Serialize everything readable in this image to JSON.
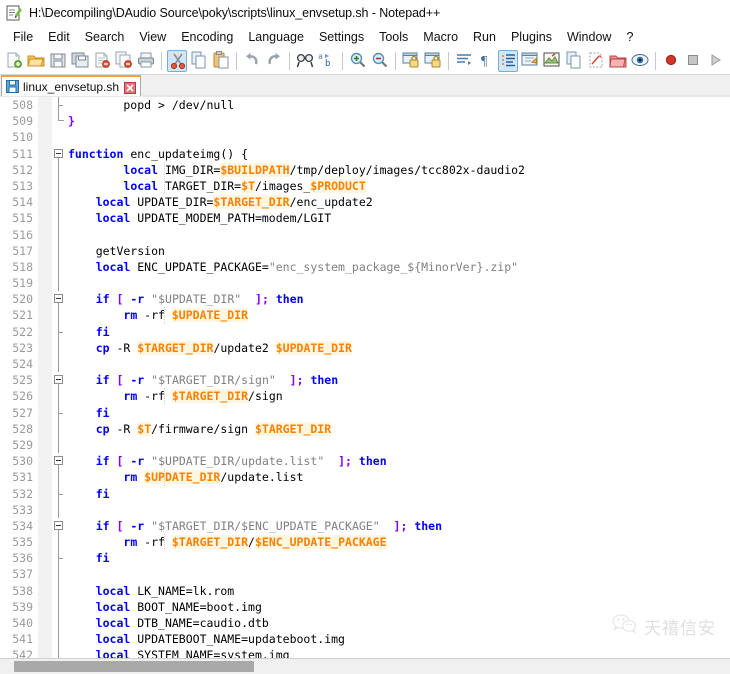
{
  "window": {
    "title": "H:\\Decompiling\\DAudio Source\\poky\\scripts\\linux_envsetup.sh - Notepad++",
    "app_icon": "notepad-plus-plus-icon"
  },
  "menubar": {
    "items": [
      {
        "label": "File"
      },
      {
        "label": "Edit"
      },
      {
        "label": "Search"
      },
      {
        "label": "View"
      },
      {
        "label": "Encoding"
      },
      {
        "label": "Language"
      },
      {
        "label": "Settings"
      },
      {
        "label": "Tools"
      },
      {
        "label": "Macro"
      },
      {
        "label": "Run"
      },
      {
        "label": "Plugins"
      },
      {
        "label": "Window"
      },
      {
        "label": "?"
      }
    ]
  },
  "toolbar": {
    "buttons": [
      {
        "name": "new-file-icon"
      },
      {
        "name": "open-file-icon"
      },
      {
        "name": "save-icon"
      },
      {
        "name": "save-all-icon"
      },
      {
        "name": "close-file-icon"
      },
      {
        "name": "close-all-icon"
      },
      {
        "name": "print-icon"
      },
      {
        "name": "cut-icon"
      },
      {
        "name": "copy-icon"
      },
      {
        "name": "paste-icon"
      },
      {
        "name": "undo-icon"
      },
      {
        "name": "redo-icon"
      },
      {
        "name": "find-icon"
      },
      {
        "name": "replace-icon"
      },
      {
        "name": "zoom-in-icon"
      },
      {
        "name": "zoom-out-icon"
      },
      {
        "name": "sync-vertical-scroll-icon"
      },
      {
        "name": "sync-horizontal-scroll-icon"
      },
      {
        "name": "word-wrap-icon"
      },
      {
        "name": "show-all-characters-icon"
      },
      {
        "name": "show-indent-guide-icon"
      },
      {
        "name": "user-defined-dialog-icon"
      },
      {
        "name": "document-map-icon"
      },
      {
        "name": "function-list-icon"
      },
      {
        "name": "folder-as-workspace-icon"
      },
      {
        "name": "monitoring-icon"
      },
      {
        "name": "record-macro-icon"
      },
      {
        "name": "stop-macro-icon"
      },
      {
        "name": "playback-macro-icon"
      }
    ]
  },
  "tabs": [
    {
      "label": "linux_envsetup.sh",
      "save_icon": "save-blue-icon",
      "close_icon": "close-red-icon",
      "active": true
    }
  ],
  "editor": {
    "first_line": 508,
    "lines": [
      {
        "n": 508,
        "fold": "line-end-tick",
        "indent_guides": [],
        "tokens": [
          {
            "t": "        popd > /dev/null",
            "c": "plain"
          }
        ]
      },
      {
        "n": 509,
        "fold": "end",
        "indent_guides": [],
        "tokens": [
          {
            "t": "}",
            "c": "op"
          }
        ]
      },
      {
        "n": 510,
        "fold": "none",
        "indent_guides": [],
        "tokens": []
      },
      {
        "n": 511,
        "fold": "box-open",
        "indent_guides": [],
        "tokens": [
          {
            "t": "function",
            "c": "kw"
          },
          {
            "t": " enc_updateimg() {",
            "c": "plain"
          }
        ]
      },
      {
        "n": 512,
        "fold": "line",
        "indent_guides": [
          98
        ],
        "tokens": [
          {
            "t": "        ",
            "c": "plain"
          },
          {
            "t": "local",
            "c": "kw"
          },
          {
            "t": " IMG_DIR=",
            "c": "plain"
          },
          {
            "t": "$BUILDPATH",
            "c": "var"
          },
          {
            "t": "/tmp/deploy/images/tcc802x-daudio2",
            "c": "plain"
          }
        ]
      },
      {
        "n": 513,
        "fold": "line",
        "indent_guides": [
          98
        ],
        "tokens": [
          {
            "t": "        ",
            "c": "plain"
          },
          {
            "t": "local",
            "c": "kw"
          },
          {
            "t": " TARGET_DIR=",
            "c": "plain"
          },
          {
            "t": "$T",
            "c": "var"
          },
          {
            "t": "/images_",
            "c": "plain"
          },
          {
            "t": "$PRODUCT",
            "c": "var"
          }
        ]
      },
      {
        "n": 514,
        "fold": "line",
        "indent_guides": [],
        "tokens": [
          {
            "t": "    ",
            "c": "plain"
          },
          {
            "t": "local",
            "c": "kw"
          },
          {
            "t": " UPDATE_DIR=",
            "c": "plain"
          },
          {
            "t": "$TARGET_DIR",
            "c": "var"
          },
          {
            "t": "/enc_update2",
            "c": "plain"
          }
        ]
      },
      {
        "n": 515,
        "fold": "line",
        "indent_guides": [],
        "tokens": [
          {
            "t": "    ",
            "c": "plain"
          },
          {
            "t": "local",
            "c": "kw"
          },
          {
            "t": " UPDATE_MODEM_PATH=modem/LGIT",
            "c": "plain"
          }
        ]
      },
      {
        "n": 516,
        "fold": "line",
        "indent_guides": [],
        "tokens": []
      },
      {
        "n": 517,
        "fold": "line",
        "indent_guides": [],
        "tokens": [
          {
            "t": "    getVersion",
            "c": "plain"
          }
        ]
      },
      {
        "n": 518,
        "fold": "line",
        "indent_guides": [],
        "tokens": [
          {
            "t": "    ",
            "c": "plain"
          },
          {
            "t": "local",
            "c": "kw"
          },
          {
            "t": " ENC_UPDATE_PACKAGE=",
            "c": "plain"
          },
          {
            "t": "\"enc_system_package_${MinorVer}.zip\"",
            "c": "str"
          }
        ]
      },
      {
        "n": 519,
        "fold": "line",
        "indent_guides": [],
        "tokens": []
      },
      {
        "n": 520,
        "fold": "box-open",
        "indent_guides": [],
        "tokens": [
          {
            "t": "    ",
            "c": "plain"
          },
          {
            "t": "if",
            "c": "kw"
          },
          {
            "t": " ",
            "c": "plain"
          },
          {
            "t": "[",
            "c": "op"
          },
          {
            "t": " ",
            "c": "plain"
          },
          {
            "t": "-r",
            "c": "kw"
          },
          {
            "t": " ",
            "c": "plain"
          },
          {
            "t": "\"$UPDATE_DIR\"",
            "c": "str"
          },
          {
            "t": "  ",
            "c": "plain"
          },
          {
            "t": "];",
            "c": "op"
          },
          {
            "t": " ",
            "c": "plain"
          },
          {
            "t": "then",
            "c": "kw"
          }
        ]
      },
      {
        "n": 521,
        "fold": "line",
        "indent_guides": [
          98
        ],
        "tokens": [
          {
            "t": "        ",
            "c": "plain"
          },
          {
            "t": "rm",
            "c": "kw"
          },
          {
            "t": " -rf ",
            "c": "plain"
          },
          {
            "t": "$UPDATE_DIR",
            "c": "var"
          }
        ]
      },
      {
        "n": 522,
        "fold": "line-end-tick",
        "indent_guides": [],
        "tokens": [
          {
            "t": "    ",
            "c": "plain"
          },
          {
            "t": "fi",
            "c": "kw"
          }
        ]
      },
      {
        "n": 523,
        "fold": "line",
        "indent_guides": [],
        "tokens": [
          {
            "t": "    ",
            "c": "plain"
          },
          {
            "t": "cp",
            "c": "kw"
          },
          {
            "t": " -R ",
            "c": "plain"
          },
          {
            "t": "$TARGET_DIR",
            "c": "var"
          },
          {
            "t": "/update2 ",
            "c": "plain"
          },
          {
            "t": "$UPDATE_DIR",
            "c": "var"
          }
        ]
      },
      {
        "n": 524,
        "fold": "line",
        "indent_guides": [],
        "tokens": []
      },
      {
        "n": 525,
        "fold": "box-open",
        "indent_guides": [],
        "tokens": [
          {
            "t": "    ",
            "c": "plain"
          },
          {
            "t": "if",
            "c": "kw"
          },
          {
            "t": " ",
            "c": "plain"
          },
          {
            "t": "[",
            "c": "op"
          },
          {
            "t": " ",
            "c": "plain"
          },
          {
            "t": "-r",
            "c": "kw"
          },
          {
            "t": " ",
            "c": "plain"
          },
          {
            "t": "\"$TARGET_DIR/sign\"",
            "c": "str"
          },
          {
            "t": "  ",
            "c": "plain"
          },
          {
            "t": "];",
            "c": "op"
          },
          {
            "t": " ",
            "c": "plain"
          },
          {
            "t": "then",
            "c": "kw"
          }
        ]
      },
      {
        "n": 526,
        "fold": "line",
        "indent_guides": [
          98
        ],
        "tokens": [
          {
            "t": "        ",
            "c": "plain"
          },
          {
            "t": "rm",
            "c": "kw"
          },
          {
            "t": " -rf ",
            "c": "plain"
          },
          {
            "t": "$TARGET_DIR",
            "c": "var"
          },
          {
            "t": "/sign",
            "c": "plain"
          }
        ]
      },
      {
        "n": 527,
        "fold": "line-end-tick",
        "indent_guides": [],
        "tokens": [
          {
            "t": "    ",
            "c": "plain"
          },
          {
            "t": "fi",
            "c": "kw"
          }
        ]
      },
      {
        "n": 528,
        "fold": "line",
        "indent_guides": [],
        "tokens": [
          {
            "t": "    ",
            "c": "plain"
          },
          {
            "t": "cp",
            "c": "kw"
          },
          {
            "t": " -R ",
            "c": "plain"
          },
          {
            "t": "$T",
            "c": "var"
          },
          {
            "t": "/firmware/sign ",
            "c": "plain"
          },
          {
            "t": "$TARGET_DIR",
            "c": "var"
          }
        ]
      },
      {
        "n": 529,
        "fold": "line",
        "indent_guides": [],
        "tokens": []
      },
      {
        "n": 530,
        "fold": "box-open",
        "indent_guides": [],
        "tokens": [
          {
            "t": "    ",
            "c": "plain"
          },
          {
            "t": "if",
            "c": "kw"
          },
          {
            "t": " ",
            "c": "plain"
          },
          {
            "t": "[",
            "c": "op"
          },
          {
            "t": " ",
            "c": "plain"
          },
          {
            "t": "-r",
            "c": "kw"
          },
          {
            "t": " ",
            "c": "plain"
          },
          {
            "t": "\"$UPDATE_DIR/update.list\"",
            "c": "str"
          },
          {
            "t": "  ",
            "c": "plain"
          },
          {
            "t": "];",
            "c": "op"
          },
          {
            "t": " ",
            "c": "plain"
          },
          {
            "t": "then",
            "c": "kw"
          }
        ]
      },
      {
        "n": 531,
        "fold": "line",
        "indent_guides": [
          98
        ],
        "tokens": [
          {
            "t": "        ",
            "c": "plain"
          },
          {
            "t": "rm",
            "c": "kw"
          },
          {
            "t": " ",
            "c": "plain"
          },
          {
            "t": "$UPDATE_DIR",
            "c": "var"
          },
          {
            "t": "/update.list",
            "c": "plain"
          }
        ]
      },
      {
        "n": 532,
        "fold": "line-end-tick",
        "indent_guides": [],
        "tokens": [
          {
            "t": "    ",
            "c": "plain"
          },
          {
            "t": "fi",
            "c": "kw"
          }
        ]
      },
      {
        "n": 533,
        "fold": "line",
        "indent_guides": [],
        "tokens": []
      },
      {
        "n": 534,
        "fold": "box-open",
        "indent_guides": [],
        "tokens": [
          {
            "t": "    ",
            "c": "plain"
          },
          {
            "t": "if",
            "c": "kw"
          },
          {
            "t": " ",
            "c": "plain"
          },
          {
            "t": "[",
            "c": "op"
          },
          {
            "t": " ",
            "c": "plain"
          },
          {
            "t": "-r",
            "c": "kw"
          },
          {
            "t": " ",
            "c": "plain"
          },
          {
            "t": "\"$TARGET_DIR/$ENC_UPDATE_PACKAGE\"",
            "c": "str"
          },
          {
            "t": "  ",
            "c": "plain"
          },
          {
            "t": "];",
            "c": "op"
          },
          {
            "t": " ",
            "c": "plain"
          },
          {
            "t": "then",
            "c": "kw"
          }
        ]
      },
      {
        "n": 535,
        "fold": "line",
        "indent_guides": [
          98
        ],
        "tokens": [
          {
            "t": "        ",
            "c": "plain"
          },
          {
            "t": "rm",
            "c": "kw"
          },
          {
            "t": " -rf ",
            "c": "plain"
          },
          {
            "t": "$TARGET_DIR",
            "c": "var"
          },
          {
            "t": "/",
            "c": "plain"
          },
          {
            "t": "$ENC_UPDATE_PACKAGE",
            "c": "var"
          }
        ]
      },
      {
        "n": 536,
        "fold": "line-end-tick",
        "indent_guides": [],
        "tokens": [
          {
            "t": "    ",
            "c": "plain"
          },
          {
            "t": "fi",
            "c": "kw"
          }
        ]
      },
      {
        "n": 537,
        "fold": "line",
        "indent_guides": [],
        "tokens": []
      },
      {
        "n": 538,
        "fold": "line",
        "indent_guides": [],
        "tokens": [
          {
            "t": "    ",
            "c": "plain"
          },
          {
            "t": "local",
            "c": "kw"
          },
          {
            "t": " LK_NAME=lk.rom",
            "c": "plain"
          }
        ]
      },
      {
        "n": 539,
        "fold": "line",
        "indent_guides": [],
        "tokens": [
          {
            "t": "    ",
            "c": "plain"
          },
          {
            "t": "local",
            "c": "kw"
          },
          {
            "t": " BOOT_NAME=boot.img",
            "c": "plain"
          }
        ]
      },
      {
        "n": 540,
        "fold": "line",
        "indent_guides": [],
        "tokens": [
          {
            "t": "    ",
            "c": "plain"
          },
          {
            "t": "local",
            "c": "kw"
          },
          {
            "t": " DTB_NAME=caudio.dtb",
            "c": "plain"
          }
        ]
      },
      {
        "n": 541,
        "fold": "line",
        "indent_guides": [],
        "tokens": [
          {
            "t": "    ",
            "c": "plain"
          },
          {
            "t": "local",
            "c": "kw"
          },
          {
            "t": " UPDATEBOOT_NAME=updateboot.img",
            "c": "plain"
          }
        ]
      },
      {
        "n": 542,
        "fold": "line",
        "indent_guides": [],
        "tokens": [
          {
            "t": "    ",
            "c": "plain"
          },
          {
            "t": "local",
            "c": "kw"
          },
          {
            "t": " SYSTEM_NAME=system.img",
            "c": "plain"
          }
        ]
      }
    ]
  },
  "watermark": {
    "text": "天禧信安",
    "icon": "wechat-icon"
  },
  "colors": {
    "keyword": "#0000ff",
    "variable": "#ff8000",
    "variable_bg": "#fff6e0",
    "string": "#808080",
    "operator": "#8000ff",
    "line_number": "#9a9a9a",
    "tab_accent": "#f2a33c"
  }
}
